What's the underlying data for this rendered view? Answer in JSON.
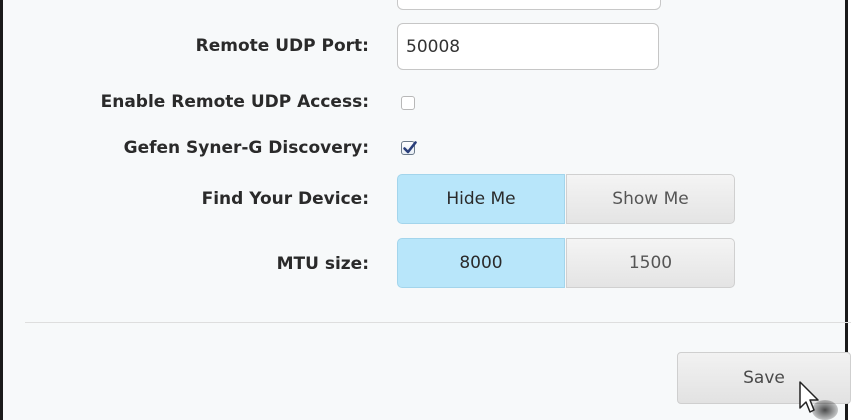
{
  "form": {
    "remote_udp_port": {
      "label": "Remote UDP Port:",
      "value": "50008"
    },
    "enable_remote_udp_access": {
      "label": "Enable Remote UDP Access:",
      "checked": false
    },
    "gefen_discovery": {
      "label": "Gefen Syner-G Discovery:",
      "checked": true
    },
    "find_your_device": {
      "label": "Find Your Device:",
      "options": [
        "Hide Me",
        "Show Me"
      ],
      "selected": "Hide Me"
    },
    "mtu_size": {
      "label": "MTU size:",
      "options": [
        "8000",
        "1500"
      ],
      "selected": "8000"
    }
  },
  "actions": {
    "save_label": "Save"
  },
  "colors": {
    "active_segment": "#b8e6fa",
    "inactive_segment": "#e8e8e8",
    "checkbox_check": "#2a3f7a"
  },
  "icons": {
    "cursor": "mouse-pointer-icon",
    "checkmark": "checkmark-icon"
  }
}
